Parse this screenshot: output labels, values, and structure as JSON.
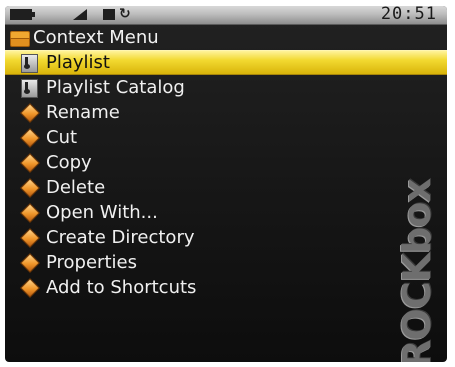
{
  "status": {
    "time": "20:51",
    "repeat_icon": "repeat-icon"
  },
  "title": "Context Menu",
  "menu": {
    "items": [
      {
        "label": "Playlist",
        "icon": "playlist-icon",
        "selected": true
      },
      {
        "label": "Playlist Catalog",
        "icon": "playlist-icon"
      },
      {
        "label": "Rename",
        "icon": "diamond-icon"
      },
      {
        "label": "Cut",
        "icon": "diamond-icon"
      },
      {
        "label": "Copy",
        "icon": "diamond-icon"
      },
      {
        "label": "Delete",
        "icon": "diamond-icon"
      },
      {
        "label": "Open With...",
        "icon": "diamond-icon"
      },
      {
        "label": "Create Directory",
        "icon": "diamond-icon"
      },
      {
        "label": "Properties",
        "icon": "diamond-icon"
      },
      {
        "label": "Add to Shortcuts",
        "icon": "diamond-icon"
      }
    ]
  },
  "logo_text": "ROCKbox",
  "colors": {
    "selection": "#f2d930",
    "background": "#1a1a1a",
    "text": "#f0f0f0"
  }
}
